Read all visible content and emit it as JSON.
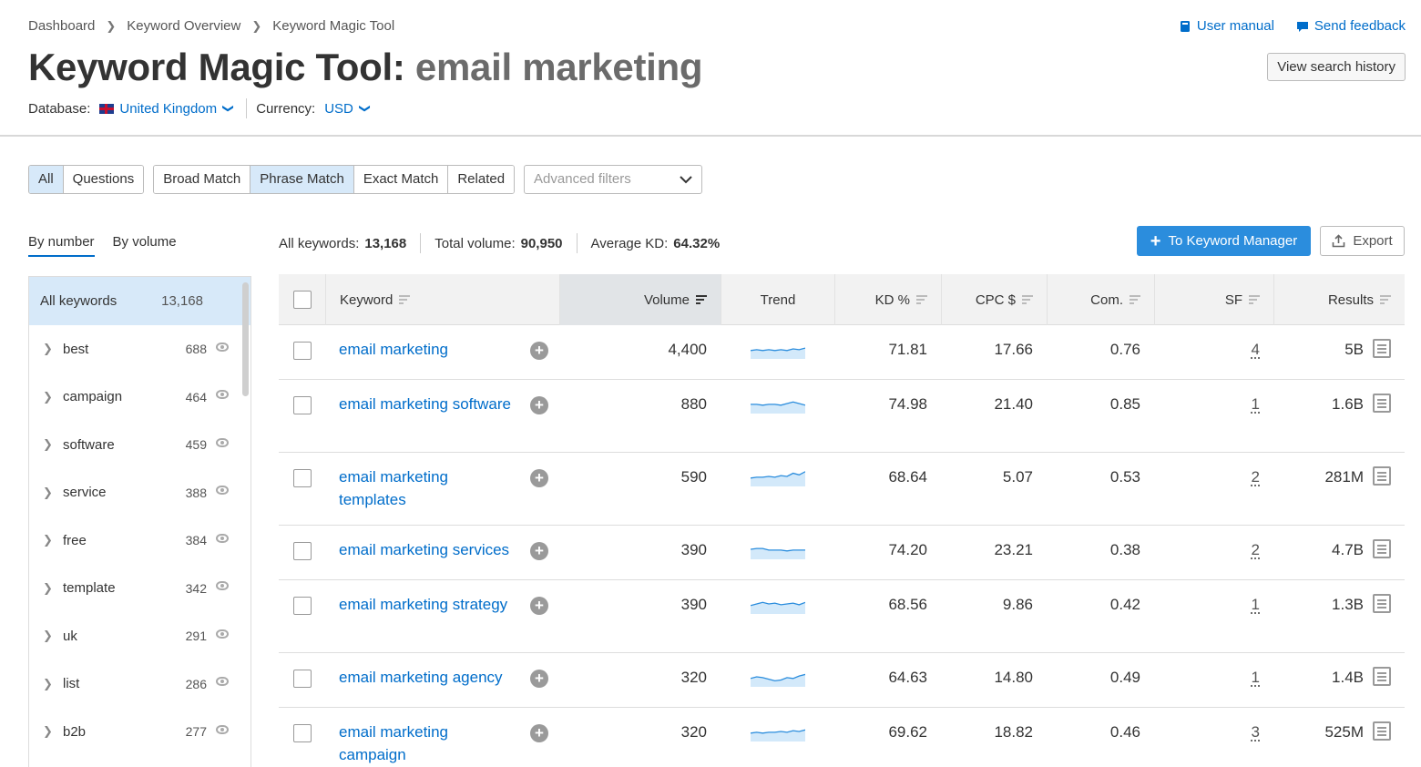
{
  "breadcrumb": [
    "Dashboard",
    "Keyword Overview",
    "Keyword Magic Tool"
  ],
  "header": {
    "title_tool": "Keyword Magic Tool:",
    "title_query": "email marketing",
    "user_manual": "User manual",
    "send_feedback": "Send feedback",
    "view_history": "View search history",
    "database_label": "Database:",
    "database_value": "United Kingdom",
    "currency_label": "Currency:",
    "currency_value": "USD"
  },
  "filters": {
    "type_tabs": [
      "All",
      "Questions"
    ],
    "match_tabs": [
      "Broad Match",
      "Phrase Match",
      "Exact Match",
      "Related"
    ],
    "advanced_placeholder": "Advanced filters"
  },
  "sidebar": {
    "tabs": [
      "By number",
      "By volume"
    ],
    "all_label": "All keywords",
    "all_count": "13,168",
    "groups": [
      {
        "label": "best",
        "count": "688"
      },
      {
        "label": "campaign",
        "count": "464"
      },
      {
        "label": "software",
        "count": "459"
      },
      {
        "label": "service",
        "count": "388"
      },
      {
        "label": "free",
        "count": "384"
      },
      {
        "label": "template",
        "count": "342"
      },
      {
        "label": "uk",
        "count": "291"
      },
      {
        "label": "list",
        "count": "286"
      },
      {
        "label": "b2b",
        "count": "277"
      }
    ]
  },
  "stats": {
    "all_keywords_label": "All keywords:",
    "all_keywords_value": "13,168",
    "total_volume_label": "Total volume:",
    "total_volume_value": "90,950",
    "avg_kd_label": "Average KD:",
    "avg_kd_value": "64.32%"
  },
  "actions": {
    "keyword_manager": "To Keyword Manager",
    "export": "Export"
  },
  "table": {
    "columns": [
      "Keyword",
      "Volume",
      "Trend",
      "KD %",
      "CPC $",
      "Com.",
      "SF",
      "Results"
    ],
    "rows": [
      {
        "keyword": "email marketing",
        "volume": "4,400",
        "trend": [
          6,
          7,
          6,
          7,
          6,
          7,
          6,
          8,
          7,
          9
        ],
        "kd": "71.81",
        "cpc": "17.66",
        "com": "0.76",
        "sf": "4",
        "results": "5B"
      },
      {
        "keyword": "email marketing software",
        "volume": "880",
        "trend": [
          7,
          7,
          6,
          7,
          7,
          6,
          8,
          10,
          8,
          6
        ],
        "kd": "74.98",
        "cpc": "21.40",
        "com": "0.85",
        "sf": "1",
        "results": "1.6B"
      },
      {
        "keyword": "email marketing templates",
        "volume": "590",
        "trend": [
          6,
          7,
          7,
          8,
          7,
          9,
          8,
          12,
          10,
          14
        ],
        "kd": "68.64",
        "cpc": "5.07",
        "com": "0.53",
        "sf": "2",
        "results": "281M"
      },
      {
        "keyword": "email marketing services",
        "volume": "390",
        "trend": [
          8,
          9,
          9,
          7,
          7,
          7,
          6,
          7,
          7,
          7
        ],
        "kd": "74.20",
        "cpc": "23.21",
        "com": "0.38",
        "sf": "2",
        "results": "4.7B"
      },
      {
        "keyword": "email marketing strategy",
        "volume": "390",
        "trend": [
          6,
          8,
          10,
          8,
          9,
          7,
          8,
          9,
          7,
          10
        ],
        "kd": "68.56",
        "cpc": "9.86",
        "com": "0.42",
        "sf": "1",
        "results": "1.3B"
      },
      {
        "keyword": "email marketing agency",
        "volume": "320",
        "trend": [
          6,
          8,
          7,
          5,
          3,
          4,
          7,
          6,
          9,
          11
        ],
        "kd": "64.63",
        "cpc": "14.80",
        "com": "0.49",
        "sf": "1",
        "results": "1.4B"
      },
      {
        "keyword": "email marketing campaign",
        "volume": "320",
        "trend": [
          6,
          7,
          6,
          7,
          7,
          8,
          7,
          9,
          8,
          10
        ],
        "kd": "69.62",
        "cpc": "18.82",
        "com": "0.46",
        "sf": "3",
        "results": "525M"
      }
    ]
  }
}
